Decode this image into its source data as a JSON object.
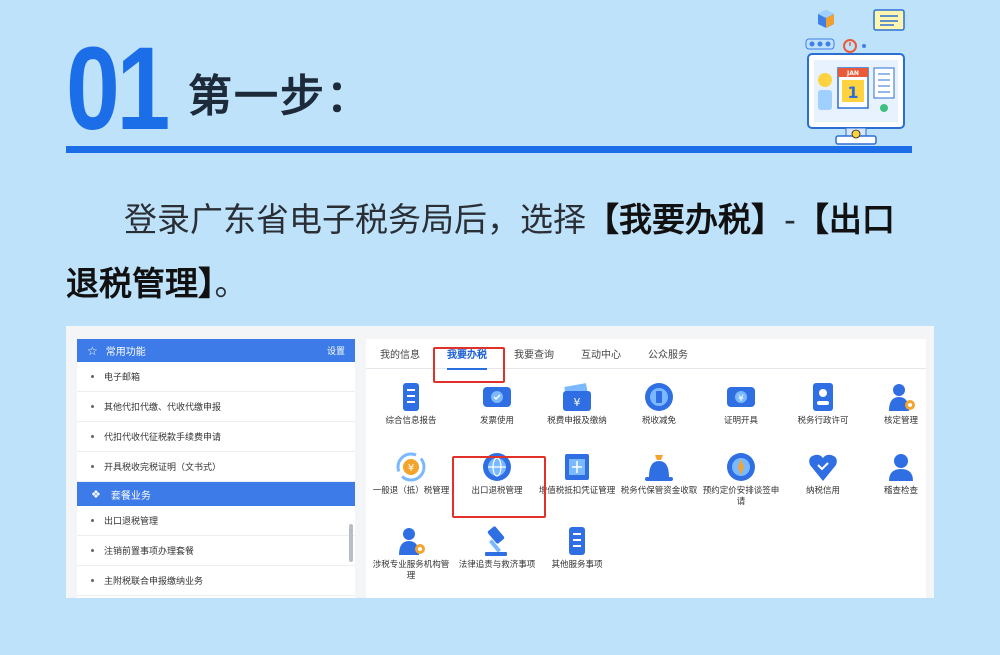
{
  "header": {
    "step_number": "01",
    "step_title": "第一步："
  },
  "instruction": {
    "prefix": "登录广东省电子税务局后，选择",
    "highlight1": "【我要办税】",
    "separator": "-",
    "highlight2": "【出口退税管理】",
    "suffix": "。"
  },
  "sidebar": {
    "header_label": "常用功能",
    "settings_label": "设置",
    "items": [
      "电子邮箱",
      "其他代扣代缴、代收代缴申报",
      "代扣代收代征税款手续费申请",
      "开具税收完税证明（文书式）"
    ],
    "section2_label": "套餐业务",
    "items2": [
      "出口退税管理",
      "注销前置事项办理套餐",
      "主附税联合申报缴纳业务"
    ]
  },
  "tabs": [
    "我的信息",
    "我要办税",
    "我要查询",
    "互动中心",
    "公众服务"
  ],
  "active_tab": "我要办税",
  "services": [
    {
      "label": "综合信息报告",
      "icon": "document-icon"
    },
    {
      "label": "发票使用",
      "icon": "ticket-icon"
    },
    {
      "label": "税费申报及缴纳",
      "icon": "wallet-icon"
    },
    {
      "label": "税收减免",
      "icon": "coin-icon"
    },
    {
      "label": "证明开具",
      "icon": "certificate-icon"
    },
    {
      "label": "税务行政许可",
      "icon": "id-card-icon"
    },
    {
      "label": "核定管理",
      "icon": "user-gear-icon"
    },
    {
      "label": "一般退（抵）税管理",
      "icon": "refund-icon"
    },
    {
      "label": "出口退税管理",
      "icon": "globe-icon"
    },
    {
      "label": "增值税抵扣凭证管理",
      "icon": "voucher-icon"
    },
    {
      "label": "税务代保管资金收取",
      "icon": "money-bag-icon"
    },
    {
      "label": "预约定价安排谈签申请",
      "icon": "compass-icon"
    },
    {
      "label": "纳税信用",
      "icon": "heart-shield-icon"
    },
    {
      "label": "稽查检查",
      "icon": "inspector-icon"
    },
    {
      "label": "涉税专业服务机构管理",
      "icon": "agent-gear-icon"
    },
    {
      "label": "法律追责与救济事项",
      "icon": "gavel-icon"
    },
    {
      "label": "其他服务事项",
      "icon": "list-icon"
    }
  ],
  "colors": {
    "accent": "#1b6ee8",
    "background": "#bfe2fb",
    "highlight_border": "#e0322b"
  }
}
